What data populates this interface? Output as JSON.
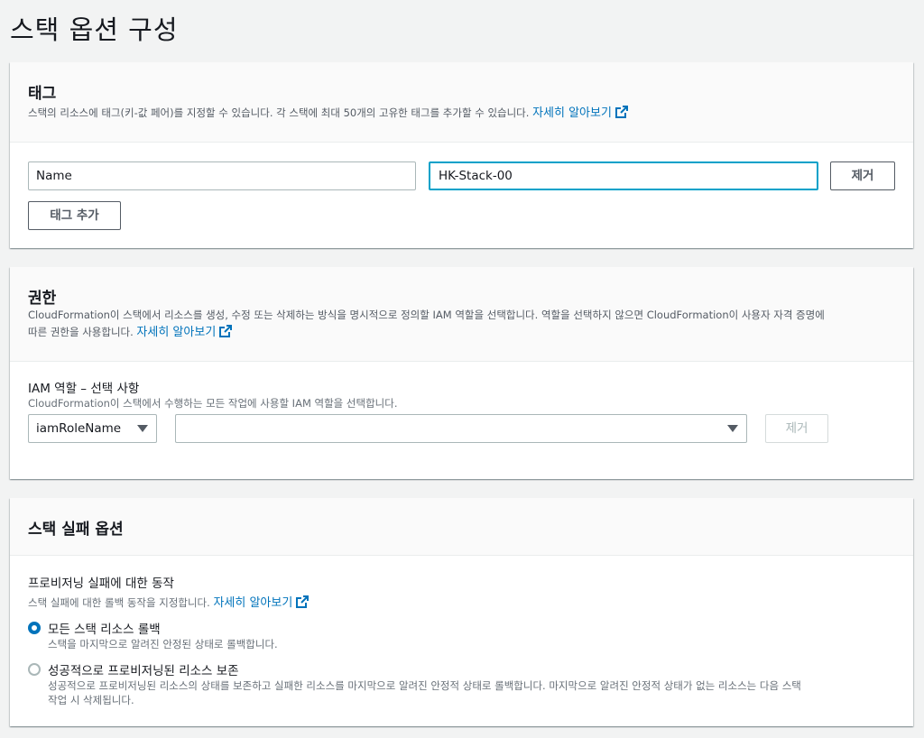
{
  "page": {
    "title": "스택 옵션 구성"
  },
  "tags": {
    "title": "태그",
    "description": "스택의 리소스에 태그(키-값 페어)를 지정할 수 있습니다. 각 스택에 최대 50개의 고유한 태그를 추가할 수 있습니다.",
    "learn_more": "자세히 알아보기",
    "key_value": "Name",
    "value_value": "HK-Stack-00",
    "remove_label": "제거",
    "add_label": "태그 추가"
  },
  "permissions": {
    "title": "권한",
    "description_line1": "CloudFormation이 스택에서 리소스를 생성, 수정 또는 삭제하는 방식을 명시적으로 정의할 IAM 역할을 선택합니다. 역할을 선택하지 않으면 CloudFormation이 사용자 자격 증명에",
    "description_line2": "따른 권한을 사용합니다.",
    "learn_more": "자세히 알아보기",
    "iam_label": "IAM 역할 – 선택 사항",
    "iam_desc": "CloudFormation이 스택에서 수행하는 모든 작업에 사용할 IAM 역할을 선택합니다.",
    "role_type_selected": "iamRoleName",
    "role_value": "",
    "remove_label": "제거"
  },
  "failure": {
    "title": "스택 실패 옵션",
    "behavior_label": "프로비저닝 실패에 대한 동작",
    "behavior_desc": "스택 실패에 대한 롤백 동작을 지정합니다.",
    "learn_more": "자세히 알아보기",
    "options": [
      {
        "label": "모든 스택 리소스 롤백",
        "desc": "스택을 마지막으로 알려진 안정된 상태로 롤백합니다.",
        "checked": true
      },
      {
        "label": "성공적으로 프로비저닝된 리소스 보존",
        "desc_line1": "성공적으로 프로비저닝된 리소스의 상태를 보존하고 실패한 리소스를 마지막으로 알려진 안정적 상태로 롤백합니다. 마지막으로 알려진 안정적 상태가 없는 리소스는 다음 스택",
        "desc_line2": "작업 시 삭제됩니다.",
        "checked": false
      }
    ]
  },
  "colors": {
    "link": "#0073bb",
    "focus": "#00a1c9",
    "background": "#f2f3f3"
  }
}
